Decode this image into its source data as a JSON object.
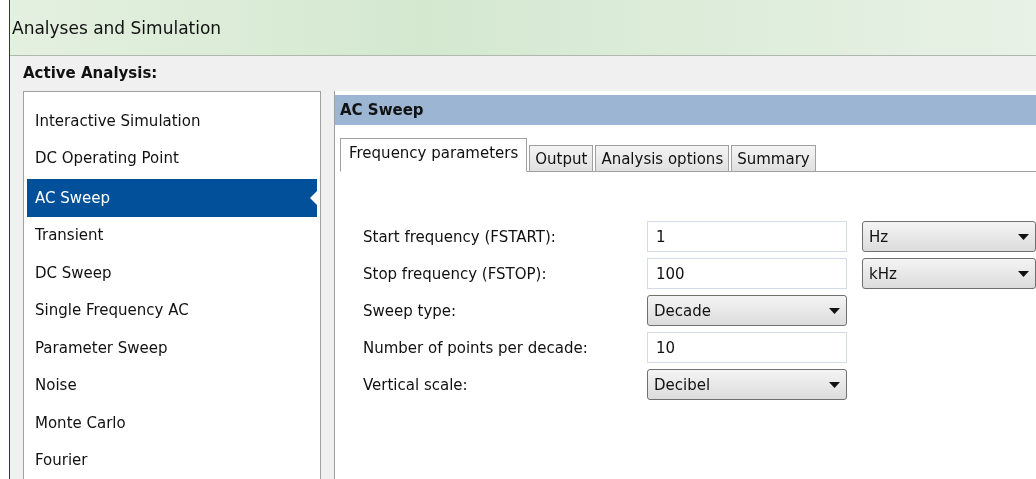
{
  "window": {
    "title": "Analyses and Simulation"
  },
  "active_analysis": {
    "label": "Active Analysis:",
    "items": [
      {
        "label": "Interactive Simulation",
        "selected": false
      },
      {
        "label": "DC Operating Point",
        "selected": false
      },
      {
        "label": "AC Sweep",
        "selected": true
      },
      {
        "label": "Transient",
        "selected": false
      },
      {
        "label": "DC Sweep",
        "selected": false
      },
      {
        "label": "Single Frequency AC",
        "selected": false
      },
      {
        "label": "Parameter Sweep",
        "selected": false
      },
      {
        "label": "Noise",
        "selected": false
      },
      {
        "label": "Monte Carlo",
        "selected": false
      },
      {
        "label": "Fourier",
        "selected": false
      }
    ]
  },
  "panel": {
    "title": "AC Sweep",
    "tabs": [
      {
        "label": "Frequency parameters",
        "selected": true
      },
      {
        "label": "Output",
        "selected": false
      },
      {
        "label": "Analysis options",
        "selected": false
      },
      {
        "label": "Summary",
        "selected": false
      }
    ],
    "fields": [
      {
        "label": "Start frequency (FSTART):",
        "kind": "text",
        "value": "1",
        "unit": "Hz"
      },
      {
        "label": "Stop frequency (FSTOP):",
        "kind": "text",
        "value": "100",
        "unit": "kHz"
      },
      {
        "label": "Sweep type:",
        "kind": "select",
        "value": "Decade"
      },
      {
        "label": "Number of points per decade:",
        "kind": "text",
        "value": "10"
      },
      {
        "label": "Vertical scale:",
        "kind": "select",
        "value": "Decibel"
      }
    ]
  }
}
